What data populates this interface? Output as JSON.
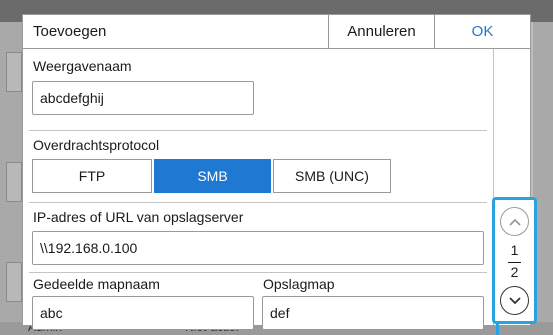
{
  "background": {
    "row_left": "Admin",
    "row_mid": "Niet-actief"
  },
  "dialog": {
    "title": "Toevoegen",
    "cancel_label": "Annuleren",
    "ok_label": "OK"
  },
  "form": {
    "display_name_label": "Weergavenaam",
    "display_name_value": "abcdefghij",
    "protocol_label": "Overdrachtsprotocol",
    "protocol_options": [
      "FTP",
      "SMB",
      "SMB (UNC)"
    ],
    "protocol_selected": "SMB",
    "server_label": "IP-adres of URL van opslagserver",
    "server_value": "\\\\192.168.0.100",
    "share_label": "Gedeelde mapnaam",
    "share_value": "abc",
    "folder_label": "Opslagmap",
    "folder_value": "def"
  },
  "pager": {
    "current": "1",
    "total": "2"
  },
  "colors": {
    "accent": "#1f78d1",
    "highlight": "#29a3e0"
  }
}
